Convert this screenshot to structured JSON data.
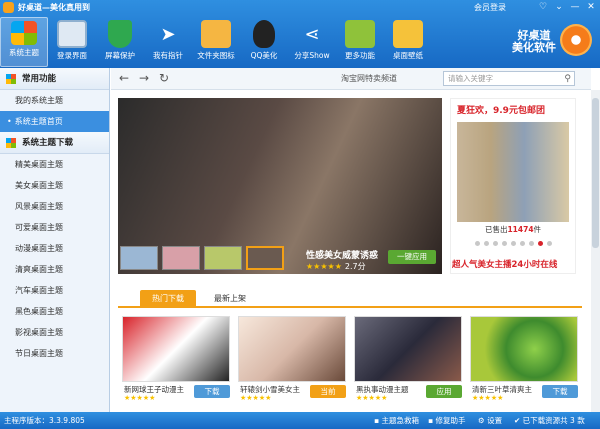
{
  "window": {
    "title": "好桌道—美化真用到",
    "login": "会员登录",
    "controls": [
      "♡",
      "⌄",
      "—",
      "✕"
    ]
  },
  "toolbar": {
    "items": [
      {
        "label": "系统主题",
        "icon": "windows-logo-icon",
        "active": true
      },
      {
        "label": "登录界面",
        "icon": "monitor-icon"
      },
      {
        "label": "屏幕保护",
        "icon": "shield-icon"
      },
      {
        "label": "我有指针",
        "icon": "paper-plane-icon"
      },
      {
        "label": "文件夹图标",
        "icon": "folder-icon"
      },
      {
        "label": "QQ美化",
        "icon": "qq-penguin-icon"
      },
      {
        "label": "分享Show",
        "icon": "share-icon"
      },
      {
        "label": "更多功能",
        "icon": "tools-icon"
      },
      {
        "label": "桌面壁纸",
        "icon": "wallpaper-icon"
      }
    ],
    "brand_line1": "好桌道",
    "brand_line2": "美化软件"
  },
  "sidebar": {
    "section1_title": "常用功能",
    "section1_items": [
      "我的系统主题",
      "系统主题首页"
    ],
    "section2_title": "系统主题下载",
    "section2_items": [
      "精美桌面主题",
      "美女桌面主题",
      "风景桌面主题",
      "可爱桌面主题",
      "动漫桌面主题",
      "清爽桌面主题",
      "汽车桌面主题",
      "黑色桌面主题",
      "影视桌面主题",
      "节日桌面主题"
    ]
  },
  "nav": {
    "back": "←",
    "forward": "→",
    "refresh": "↻",
    "page_title": "淘宝网特卖频道",
    "search_placeholder": "请输入关键字"
  },
  "hero": {
    "caption": "性感美女威蒙诱惑",
    "stars": "★★★★★",
    "score": "2.7分",
    "apply_label": "一键应用"
  },
  "promo": {
    "title": "夏狂欢，9.9元包邮团",
    "sold_prefix": "已售出",
    "sold_count": "11474",
    "sold_suffix": "件",
    "footer": "超人气美女主播24小时在线"
  },
  "tabs": {
    "hot": "热门下载",
    "new": "最新上架"
  },
  "cards": [
    {
      "name": "新网球王子动漫主",
      "stars": "★★★★★",
      "button": "下载",
      "color": "#d8232a"
    },
    {
      "name": "轩辕剑小雪美女主",
      "stars": "★★★★★",
      "button": "当前",
      "color": "#f0d8c8"
    },
    {
      "name": "黑执事动漫主题",
      "stars": "★★★★★",
      "button": "应用",
      "color": "#3a3a4a"
    },
    {
      "name": "清新三叶草清爽主",
      "stars": "★★★★★",
      "button": "下载",
      "color": "#3e8b2e"
    }
  ],
  "status": {
    "version_label": "主程序版本：3.3.9.805",
    "first_aid": "主题急救箱",
    "repair": "修复助手",
    "settings": "设置",
    "download_info": "已下载资源共 3 款"
  }
}
